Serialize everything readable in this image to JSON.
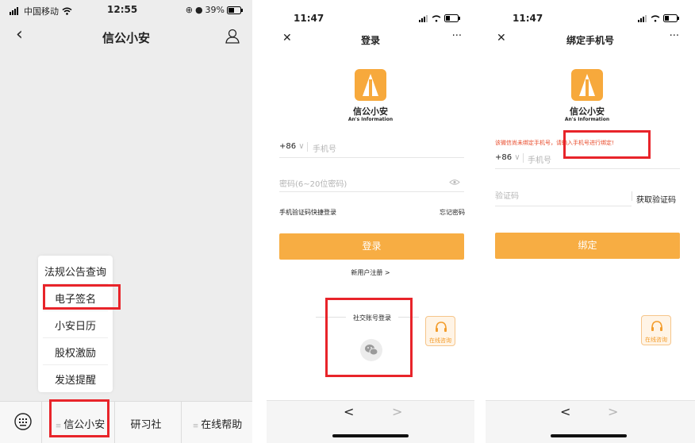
{
  "p1": {
    "status": {
      "carrier": "中国移动",
      "time": "12:55",
      "battery": "39%"
    },
    "title": "信公小安",
    "menu": [
      "法规公告查询",
      "电子签名",
      "小安日历",
      "股权激励",
      "发送提醒"
    ],
    "bottom_tabs": [
      "信公小安",
      "研习社",
      "在线帮助"
    ]
  },
  "p2": {
    "status": {
      "time": "11:47"
    },
    "title": "登录",
    "brand_cn": "信公小安",
    "brand_en": "An's Information",
    "country_code": "+86",
    "phone_placeholder": "手机号",
    "password_placeholder": "密码(6~20位密码)",
    "quick_login": "手机验证码快捷登录",
    "forgot": "忘记密码",
    "login_btn": "登录",
    "register": "新用户注册 >",
    "social_login": "社交账号登录",
    "online_consult": "在线咨询",
    "nav_back": "<",
    "nav_forward": ">"
  },
  "p3": {
    "status": {
      "time": "11:47"
    },
    "title": "绑定手机号",
    "brand_cn": "信公小安",
    "brand_en": "An's Information",
    "notice": "该微信尚未绑定手机号，请输入手机号进行绑定!",
    "country_code": "+86",
    "phone_placeholder": "手机号",
    "code_placeholder": "验证码",
    "get_code": "获取验证码",
    "bind_btn": "绑定",
    "online_consult": "在线咨询",
    "nav_back": "<",
    "nav_forward": ">"
  },
  "colors": {
    "accent": "#f7ad43",
    "highlight_box": "#e8242a",
    "notice": "#e84a2a"
  },
  "icons": [
    "signal-icon",
    "wifi-icon",
    "battery-icon",
    "back-icon",
    "profile-icon",
    "close-icon",
    "more-icon",
    "eye-icon",
    "keyboard-icon",
    "menu-lines-icon",
    "wechat-icon",
    "headset-icon",
    "chevron-down-icon"
  ]
}
